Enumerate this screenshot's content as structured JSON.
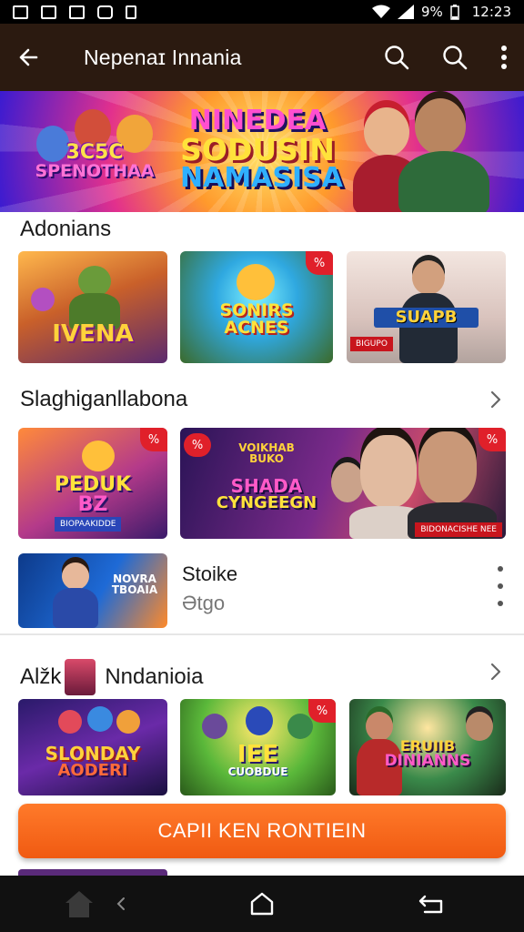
{
  "status_bar": {
    "battery": "9%",
    "time": "12:23"
  },
  "app_bar": {
    "title": "Nepenaɪ Innania"
  },
  "hero": {
    "title_lines": [
      "NINEDEA",
      "SODUSIN",
      "NAMASISA"
    ],
    "side_text_lines": [
      "3C5C",
      "SPENOTHAA"
    ]
  },
  "sections": [
    {
      "title": "Adonians",
      "tiles": [
        {
          "title": "IVENA"
        },
        {
          "title_lines": [
            "SONIRS",
            "ACNES"
          ],
          "badge": "%"
        },
        {
          "title": "SUAPB",
          "ribbon": "BIGUPO"
        }
      ]
    },
    {
      "title": "Slaghiganllabona",
      "tiles": [
        {
          "title_lines": [
            "PEDUK",
            "BZ"
          ],
          "ribbon": "BIOPAAKIDDE",
          "badge": "%"
        },
        {
          "kicker_lines": [
            "VOIKHAB",
            "BUKO"
          ],
          "title_lines": [
            "SHADA",
            "CYNGEEGN"
          ],
          "badge": "%",
          "ribbon": "BIDONACISHE NEE",
          "tag": "%"
        }
      ],
      "list_item": {
        "thumb_lines": [
          "NOVRA",
          "TBOAIA"
        ],
        "title": "Stoike",
        "subtitle": "Ətgo"
      }
    },
    {
      "title_prefix": "Alžk",
      "title": "Nndanioia",
      "tiles": [
        {
          "title_lines": [
            "SLONDAY",
            "AODERI"
          ]
        },
        {
          "title_lines": [
            "IEE",
            "CUOBDUE"
          ],
          "badge": "%"
        },
        {
          "title_lines": [
            "ERUIIB",
            "DINIANNS"
          ]
        }
      ]
    }
  ],
  "cta": {
    "label": "CAPII KEN RONTIEIN"
  },
  "colors": {
    "accent": "#f26416",
    "appbar": "#2b1a10",
    "badge": "#e0202a"
  }
}
